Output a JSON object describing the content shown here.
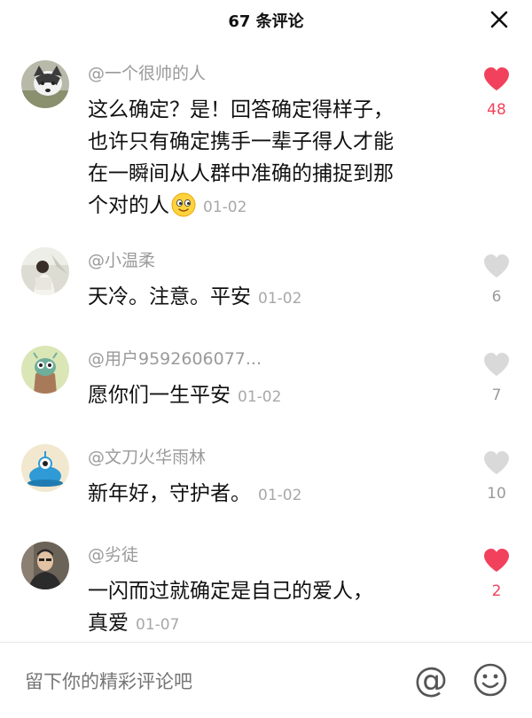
{
  "header": {
    "title": "67 条评论",
    "close_icon": "close-icon"
  },
  "comments": [
    {
      "username": "@一个很帅的人",
      "text_lines": [
        "这么确定？是！回答确定得样子，",
        "也许只有确定携手一辈子得人才能",
        "在一瞬间从人群中准确的捕捉到那",
        "个对的人"
      ],
      "emoji": "smiley-emoji-icon",
      "date": "01-02",
      "likes": "48",
      "liked": true,
      "avatar": "husky-avatar"
    },
    {
      "username": "@小温柔",
      "text": "天冷。注意。平安",
      "date": "01-02",
      "likes": "6",
      "liked": false,
      "avatar": "girl-photo-avatar"
    },
    {
      "username": "@用户9592606077...",
      "text": "愿你们一生平安",
      "date": "01-02",
      "likes": "7",
      "liked": false,
      "avatar": "green-monster-avatar"
    },
    {
      "username": "@文刀火华雨林",
      "text": "新年好，守护者。",
      "date": "01-02",
      "likes": "10",
      "liked": false,
      "avatar": "blue-monster-avatar"
    },
    {
      "username": "@劣徒",
      "text_lines": [
        "一闪而过就确定是自己的爱人，",
        "真爱"
      ],
      "date": "01-07",
      "likes": "2",
      "liked": true,
      "avatar": "man-photo-avatar"
    }
  ],
  "input_bar": {
    "placeholder": "留下你的精彩评论吧",
    "at_symbol": "@",
    "emoji_icon": "smiley-face-icon"
  },
  "colors": {
    "liked": "#f2415c",
    "unliked": "#d0d0d0",
    "secondary_text": "#9a9a9a"
  }
}
